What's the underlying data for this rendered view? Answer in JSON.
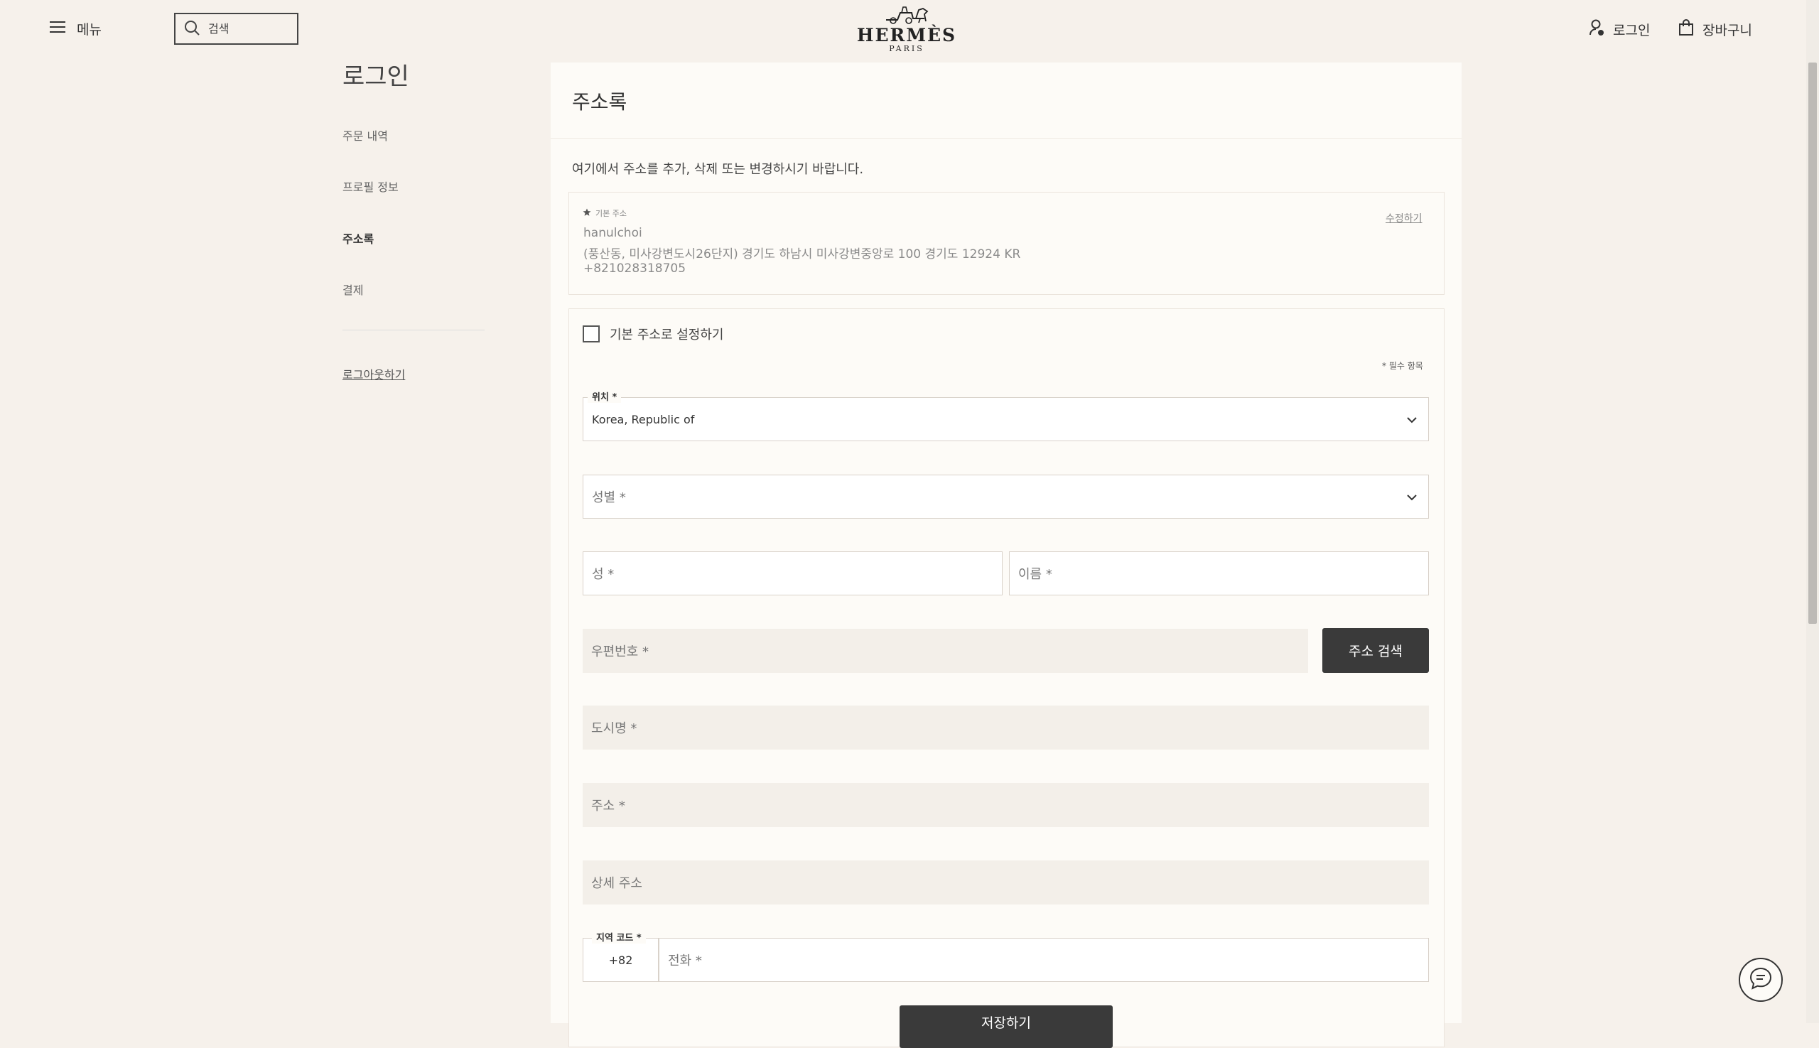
{
  "header": {
    "menu_label": "메뉴",
    "search_placeholder": "검색",
    "logo_word": "HERMÈS",
    "logo_sub": "PARIS",
    "login_label": "로그인",
    "cart_label": "장바구니"
  },
  "sidebar": {
    "title": "로그인",
    "items": [
      {
        "label": "주문 내역"
      },
      {
        "label": "프로필 정보"
      },
      {
        "label": "주소록"
      },
      {
        "label": "결제"
      }
    ],
    "logout_label": "로그아웃하기"
  },
  "main": {
    "title": "주소록",
    "intro": "여기에서 주소를 추가, 삭제 또는 변경하시기 바랍니다.",
    "default_address": {
      "label": "기본 주소",
      "edit_label": "수정하기",
      "name": "hanulchoi",
      "address": "(풍산동, 미사강변도시26단지) 경기도 하남시 미사강변중앙로 100 경기도 12924 KR",
      "phone": "+821028318705"
    },
    "form": {
      "set_default_label": "기본 주소로 설정하기",
      "required_note": "* 필수 항목",
      "location_label": "위치 *",
      "location_value": "Korea, Republic of",
      "gender_placeholder": "성별 *",
      "last_name_placeholder": "성 *",
      "first_name_placeholder": "이름 *",
      "postcode_placeholder": "우편번호 *",
      "address_search_label": "주소 검색",
      "city_placeholder": "도시명 *",
      "address_placeholder": "주소 *",
      "detail_address_placeholder": "상세 주소",
      "area_code_label": "지역 코드 *",
      "area_code_value": "+82",
      "phone_placeholder": "전화 *",
      "save_label": "저장하기"
    }
  },
  "colors": {
    "background": "#f6f1eb",
    "card": "#fdfbf7",
    "button_dark": "#3a3a3a",
    "field_gray": "#f3efe9"
  }
}
